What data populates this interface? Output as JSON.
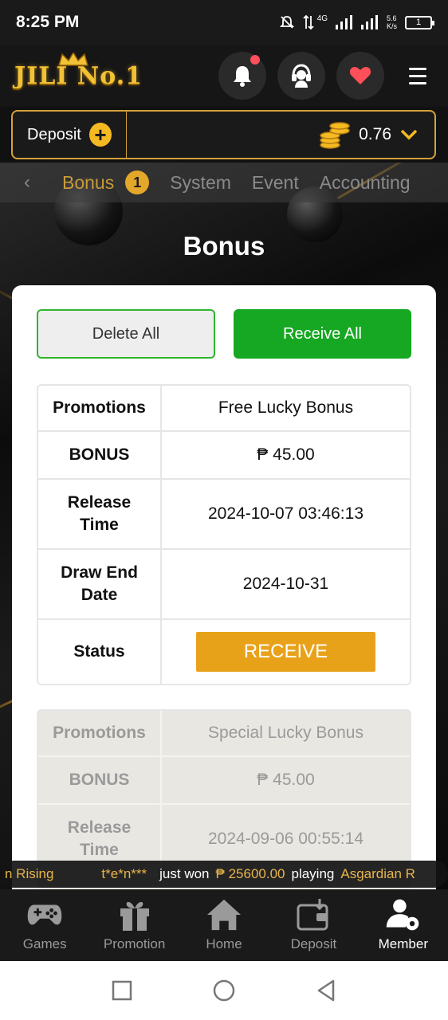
{
  "status_bar": {
    "time": "8:25 PM",
    "network": "4G",
    "speed_top": "5.6",
    "speed_unit": "K/s",
    "battery": "1"
  },
  "header": {
    "logo_text": "JILI No.1",
    "has_notification": true
  },
  "deposit_bar": {
    "label": "Deposit",
    "balance": "0.76"
  },
  "category_tabs": [
    {
      "label": "Bonus",
      "badge": "1",
      "active": true
    },
    {
      "label": "System",
      "active": false
    },
    {
      "label": "Event",
      "active": false
    },
    {
      "label": "Accounting",
      "active": false
    }
  ],
  "page_title": "Bonus",
  "actions": {
    "delete_all": "Delete All",
    "receive_all": "Receive All"
  },
  "bonuses": [
    {
      "promotions_label": "Promotions",
      "promotions_value": "Free Lucky Bonus",
      "bonus_label": "BONUS",
      "bonus_value": "₱ 45.00",
      "release_label": "Release Time",
      "release_value": "2024-10-07 03:46:13",
      "draw_end_label": "Draw End Date",
      "draw_end_value": "2024-10-31",
      "status_label": "Status",
      "status_button": "RECEIVE"
    },
    {
      "promotions_label": "Promotions",
      "promotions_value": "Special Lucky Bonus",
      "bonus_label": "BONUS",
      "bonus_value": "₱ 45.00",
      "release_label": "Release Time",
      "release_value": "2024-09-06 00:55:14"
    }
  ],
  "marquee": {
    "prefix": "n Rising",
    "user": "t*e*n***",
    "text1": "just won",
    "amount": "₱ 25600.00",
    "text2": "playing",
    "game": "Asgardian R"
  },
  "bottom_nav": [
    {
      "label": "Games",
      "icon": "gamepad-icon",
      "active": false
    },
    {
      "label": "Promotion",
      "icon": "gift-icon",
      "active": false
    },
    {
      "label": "Home",
      "icon": "home-icon",
      "active": false
    },
    {
      "label": "Deposit",
      "icon": "wallet-icon",
      "active": false
    },
    {
      "label": "Member",
      "icon": "member-icon",
      "active": true
    }
  ],
  "colors": {
    "gold": "#d4a23a",
    "green": "#16a822",
    "receive_orange": "#e8a21a",
    "notification": "#ff4f5a"
  }
}
